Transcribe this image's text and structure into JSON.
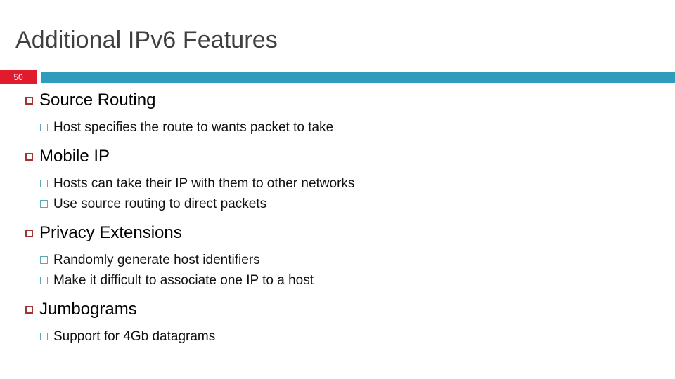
{
  "slide": {
    "title": "Additional IPv6 Features",
    "number": "50",
    "accent_teal": "#2F9CBC",
    "accent_red": "#E01B2E",
    "title_color": "#404040",
    "level1_marker_color": "#A33434",
    "level2_marker_color": "#5FA7B5",
    "background": "#FFFFFF"
  },
  "content": {
    "groups": [
      {
        "heading": "Source Routing",
        "items": [
          "Host specifies the route to wants packet to take"
        ]
      },
      {
        "heading": "Mobile IP",
        "items": [
          "Hosts can take their IP with them to other networks",
          "Use source routing to direct packets"
        ]
      },
      {
        "heading": "Privacy Extensions",
        "items": [
          "Randomly generate host identifiers",
          "Make it difficult to associate one IP to a host"
        ]
      },
      {
        "heading": "Jumbograms",
        "items": [
          "Support for 4Gb datagrams"
        ]
      }
    ]
  }
}
